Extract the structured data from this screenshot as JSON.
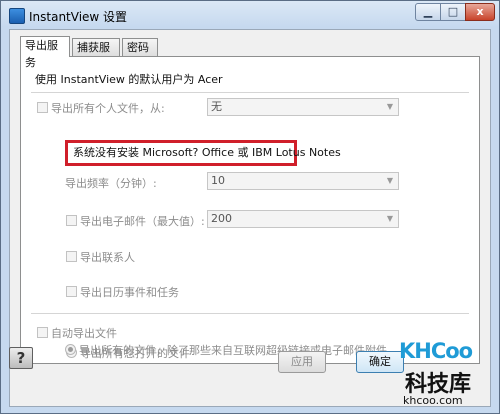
{
  "window": {
    "title": "InstantView 设置",
    "close_label": "x"
  },
  "tabs": [
    {
      "label": "导出服务",
      "active": true
    },
    {
      "label": "捕获服务",
      "active": false
    },
    {
      "label": "密码",
      "active": false
    }
  ],
  "panel": {
    "user_line": "使用 InstantView 的默认用户为 Acer",
    "export_all_files": {
      "label": "导出所有个人文件，从:",
      "select_value": "无"
    },
    "notice": "系统没有安装 Microsoft? Office 或 IBM Lotus Notes",
    "export_frequency": {
      "label": "导出频率（分钟）:",
      "value": "10"
    },
    "export_email": {
      "label": "导出电子邮件（最大值）:",
      "value": "200"
    },
    "export_contacts": "导出联系人",
    "export_calendar": "导出日历事件和任务",
    "auto_export": {
      "label": "自动导出文件",
      "option_opened": "导出所有您打开的文件",
      "option_all": "导出所有的文件，除了那些来自互联网超级链接或电子邮件附件"
    }
  },
  "buttons": {
    "help": "?",
    "apply": "应用",
    "ok": "确定"
  },
  "watermark": {
    "logo": "KHCoo",
    "text": "科技库",
    "url": "khcoo.com"
  },
  "colors": {
    "notice_border": "#d01f2a",
    "title_bar": "#c6d9ef",
    "watermark_blue": "#1f9bd6"
  }
}
